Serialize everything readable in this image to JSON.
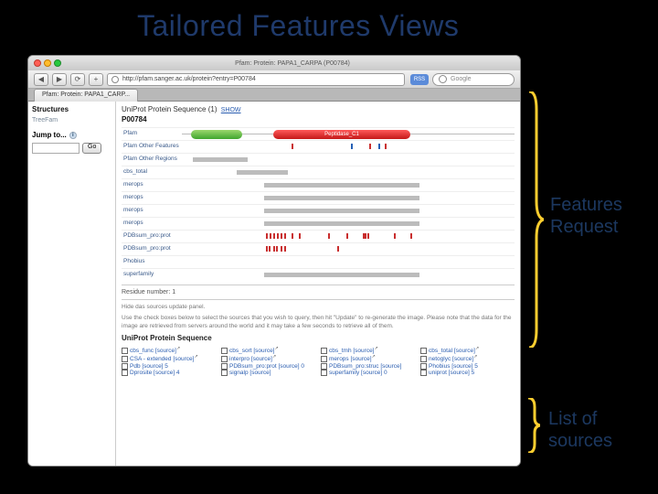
{
  "slide": {
    "title": "Tailored Features Views"
  },
  "window": {
    "title": "Pfam: Protein: PAPA1_CARPA (P00784)"
  },
  "toolbar": {
    "url": "http://pfam.sanger.ac.uk/protein?entry=P00784",
    "rss": "RSS",
    "search_placeholder": "Google"
  },
  "tab": {
    "label": "Pfam: Protein: PAPA1_CARP..."
  },
  "sidebar": {
    "heading": "Structures",
    "items": [
      "TreeFam"
    ],
    "jump_label": "Jump to...",
    "go_label": "Go"
  },
  "track_header": {
    "text_a": "UniProt Protein Sequence (1)",
    "link": "SHOW"
  },
  "protein_id": "P00784",
  "domain_label": "Peptidase_C1",
  "tracks": [
    {
      "label": "Pfam"
    },
    {
      "label": "Pfam Other Features"
    },
    {
      "label": "Pfam Other Regions"
    },
    {
      "label": "cbs_total"
    },
    {
      "label": "merops"
    },
    {
      "label": "merops"
    },
    {
      "label": "merops"
    },
    {
      "label": "merops"
    },
    {
      "label": "PDBsum_pro:prot"
    },
    {
      "label": "PDBsum_pro:prot"
    },
    {
      "label": "Phobius"
    },
    {
      "label": "superfamily"
    }
  ],
  "residue": {
    "label": "Residue number: 1"
  },
  "help_text": {
    "line1": "Hide das sources update panel.",
    "line2": "Use the check boxes below to select the sources that you wish to query, then hit \"Update\" to re-generate the image. Please note that the data for the image are retrieved from servers around the world and it may take a few seconds to retrieve all of them."
  },
  "sub_header": "UniProt Protein Sequence",
  "sources": {
    "row1": [
      "cbs_func [source]",
      "cbs_sort [source]",
      "cbs_tmh [source]",
      "cbs_total [source]"
    ],
    "row2": [
      "CSA - extended [source]",
      "interpro [source]",
      "merops [source]",
      "netoglyc [source]"
    ],
    "row3": [
      "Pdb [source] 5",
      "PDBsum_pro:prot [source] 0",
      "PDBsum_pro:struc [source]",
      "Phobius [source] 5"
    ],
    "row4": [
      "Dprosite [source] 4",
      "signalp [source]",
      "superfamily [source] 0",
      "uniprot [source] 5"
    ]
  },
  "annotations": {
    "features_request": "Features\nRequest",
    "list_sources": "List of\nsources"
  }
}
